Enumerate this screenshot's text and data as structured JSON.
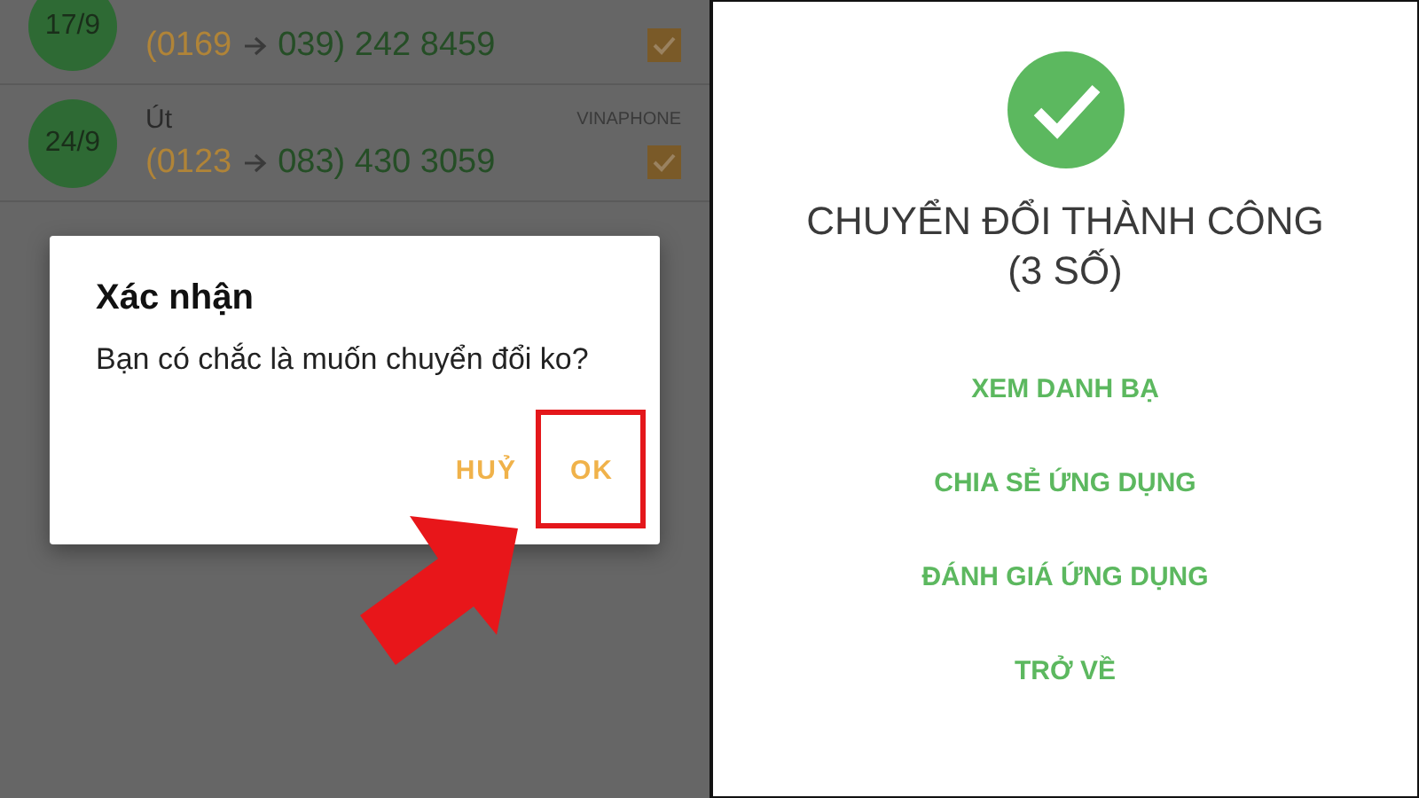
{
  "contacts": [
    {
      "date": "17/9",
      "old_prefix": "(0169",
      "new_number": "039) 242 8459",
      "checked": true
    },
    {
      "date": "24/9",
      "name": "Út",
      "carrier": "VINAPHONE",
      "old_prefix": "(0123",
      "new_number": "083) 430 3059",
      "checked": true
    }
  ],
  "dialog": {
    "title": "Xác nhận",
    "message": "Bạn có chắc là muốn chuyển đổi ko?",
    "buttons": [
      {
        "label": "HUỶ",
        "highlighted": false
      },
      {
        "label": "OK",
        "highlighted": true
      }
    ]
  },
  "result": {
    "title_lines": [
      "CHUYỂN ĐỔI THÀNH CÔNG",
      "(3 SỐ)"
    ],
    "actions": [
      "XEM DANH BẠ",
      "CHIA SẺ ỨNG DỤNG",
      "ĐÁNH GIÁ ỨNG DỤNG",
      "TRỞ VỀ"
    ]
  }
}
